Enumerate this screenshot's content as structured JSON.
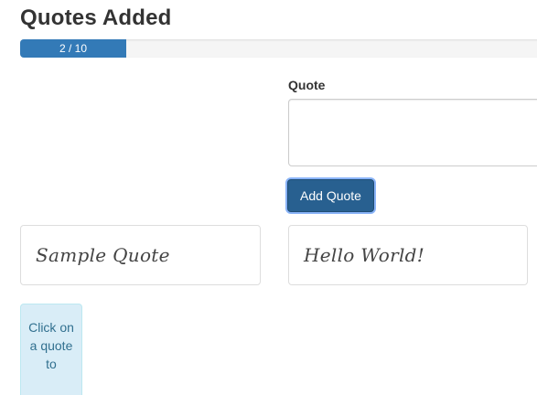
{
  "header": {
    "title": "Quotes Added"
  },
  "progress": {
    "text": "2 / 10",
    "current": 2,
    "total": 10,
    "fraction": 0.2,
    "color": "#337ab7"
  },
  "form": {
    "quote_label": "Quote",
    "quote_value": "",
    "add_button_label": "Add Quote"
  },
  "quotes": [
    {
      "text": "Sample Quote"
    },
    {
      "text": "Hello World!"
    }
  ],
  "hint": {
    "text": "Click on a quote to"
  }
}
